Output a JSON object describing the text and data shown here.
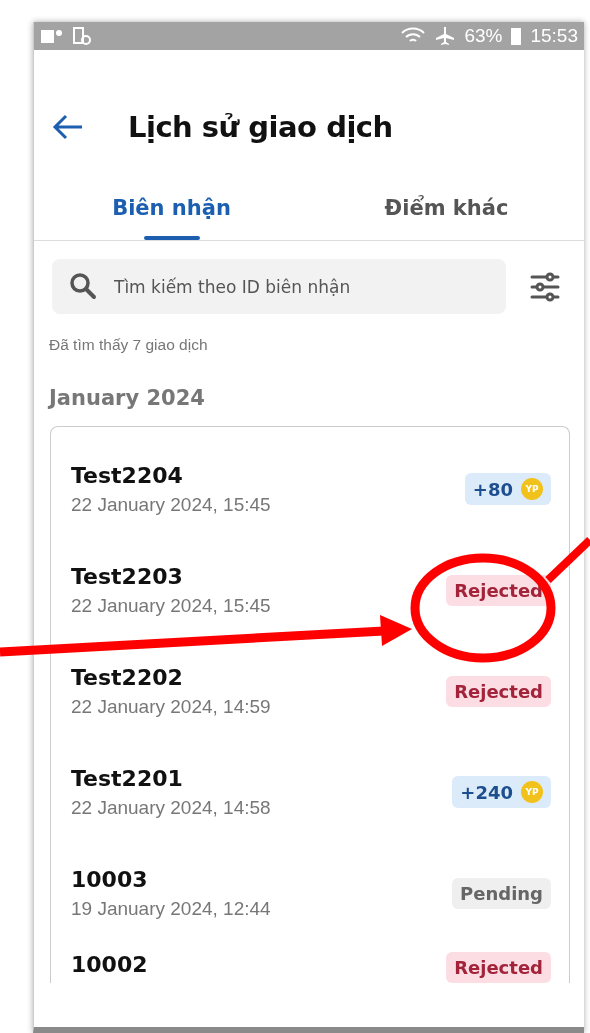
{
  "status_bar": {
    "battery": "63%",
    "time": "15:53"
  },
  "header": {
    "title": "Lịch sử giao dịch"
  },
  "tabs": [
    {
      "label": "Biên nhận",
      "selected": true
    },
    {
      "label": "Điểm khác",
      "selected": false
    }
  ],
  "search": {
    "placeholder": "Tìm kiếm theo ID biên nhận"
  },
  "result_count": "Đã tìm thấy 7 giao dịch",
  "month": "January 2024",
  "transactions": [
    {
      "id": "Test2204",
      "date": "22 January 2024, 15:45",
      "badge": {
        "kind": "points",
        "text": "+80",
        "coin_label": "YP"
      }
    },
    {
      "id": "Test2203",
      "date": "22 January 2024, 15:45",
      "badge": {
        "kind": "rejected",
        "text": "Rejected"
      }
    },
    {
      "id": "Test2202",
      "date": "22 January 2024, 14:59",
      "badge": {
        "kind": "rejected",
        "text": "Rejected"
      }
    },
    {
      "id": "Test2201",
      "date": "22 January 2024, 14:58",
      "badge": {
        "kind": "points",
        "text": "+240",
        "coin_label": "YP"
      }
    },
    {
      "id": "10003",
      "date": "19 January 2024, 12:44",
      "badge": {
        "kind": "pending",
        "text": "Pending"
      }
    },
    {
      "id": "10002",
      "badge": {
        "kind": "rejected",
        "text": "Rejected"
      }
    }
  ]
}
